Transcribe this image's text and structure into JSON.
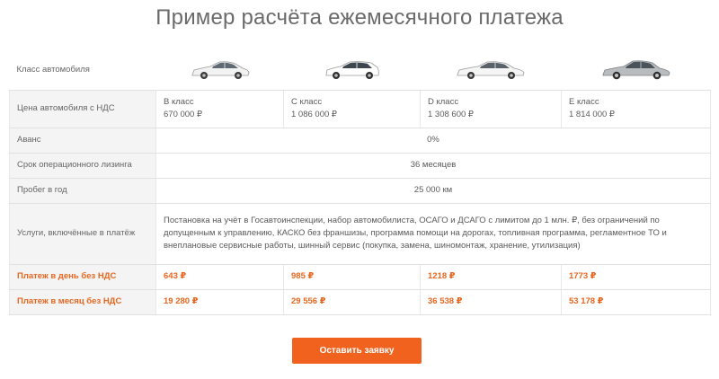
{
  "title": "Пример расчёта ежемесячного платежа",
  "rows": {
    "car_class": {
      "label": "Класс автомобиля"
    },
    "price": {
      "label": "Цена автомобиля с НДС",
      "cells": [
        {
          "class": "B класс",
          "price": "670 000 ₽"
        },
        {
          "class": "C класс",
          "price": "1 086 000 ₽"
        },
        {
          "class": "D класс",
          "price": "1 308 600 ₽"
        },
        {
          "class": "E класс",
          "price": "1 814 000 ₽"
        }
      ]
    },
    "advance": {
      "label": "Аванс",
      "value": "0%"
    },
    "term": {
      "label": "Срок операционного лизинга",
      "value": "36 месяцев"
    },
    "mileage": {
      "label": "Пробег в год",
      "value": "25 000 км"
    },
    "services": {
      "label": "Услуги, включённые в платёж",
      "value": "Постановка на учёт в Госавтоинспекции, набор автомобилиста, ОСАГО и ДСАГО с лимитом до 1 млн. ₽, без ограничений по допущенным к управлению, КАСКО без франшизы, программа помощи на дорогах, топливная программа, регламентное ТО и внеплановые сервисные работы, шинный сервис (покупка, замена, шиномонтаж, хранение, утилизация)"
    },
    "per_day": {
      "label": "Платеж в день без НДС",
      "values": [
        "643 ₽",
        "985 ₽",
        "1218 ₽",
        "1773 ₽"
      ]
    },
    "per_month": {
      "label": "Платеж в месяц без НДС",
      "values": [
        "19 280 ₽",
        "29 556 ₽",
        "36 538 ₽",
        "53 178 ₽"
      ]
    }
  },
  "cta": {
    "label": "Оставить заявку"
  },
  "colors": {
    "accent": "#f0621e",
    "highlight_text": "#e8661f",
    "label_bg": "#f4f4f4"
  },
  "icons": [
    "car-b-class-icon",
    "car-c-class-icon",
    "car-d-class-icon",
    "car-e-class-icon"
  ]
}
